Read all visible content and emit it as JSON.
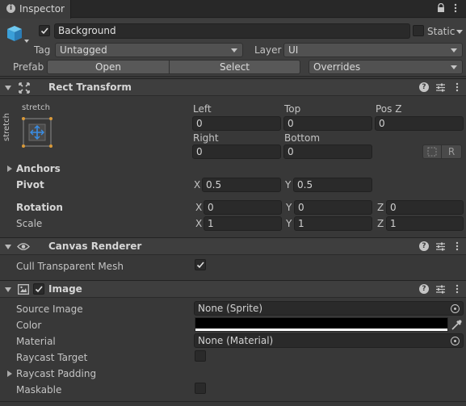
{
  "tab": {
    "label": "Inspector"
  },
  "gameobject": {
    "name": "Background",
    "static_label": "Static",
    "tag_label": "Tag",
    "tag_value": "Untagged",
    "layer_label": "Layer",
    "layer_value": "UI",
    "prefab_label": "Prefab",
    "open_label": "Open",
    "select_label": "Select",
    "overrides_label": "Overrides"
  },
  "rect_transform": {
    "title": "Rect Transform",
    "anchor_preset_h": "stretch",
    "anchor_preset_v": "stretch",
    "left_label": "Left",
    "left_value": "0",
    "top_label": "Top",
    "top_value": "0",
    "posz_label": "Pos Z",
    "posz_value": "0",
    "right_label": "Right",
    "right_value": "0",
    "bottom_label": "Bottom",
    "bottom_value": "0",
    "r_button": "R",
    "anchors_label": "Anchors",
    "pivot_label": "Pivot",
    "pivot_x": "0.5",
    "pivot_y": "0.5",
    "rotation_label": "Rotation",
    "rotation_x": "0",
    "rotation_y": "0",
    "rotation_z": "0",
    "scale_label": "Scale",
    "scale_x": "1",
    "scale_y": "1",
    "scale_z": "1",
    "x": "X",
    "y": "Y",
    "z": "Z"
  },
  "canvas_renderer": {
    "title": "Canvas Renderer",
    "cull_label": "Cull Transparent Mesh"
  },
  "image": {
    "title": "Image",
    "source_label": "Source Image",
    "source_value": "None (Sprite)",
    "color_label": "Color",
    "material_label": "Material",
    "material_value": "None (Material)",
    "raycast_target_label": "Raycast Target",
    "raycast_padding_label": "Raycast Padding",
    "maskable_label": "Maskable"
  },
  "colors": {
    "image_color": "#000000",
    "accent": "#3a8ee6"
  }
}
